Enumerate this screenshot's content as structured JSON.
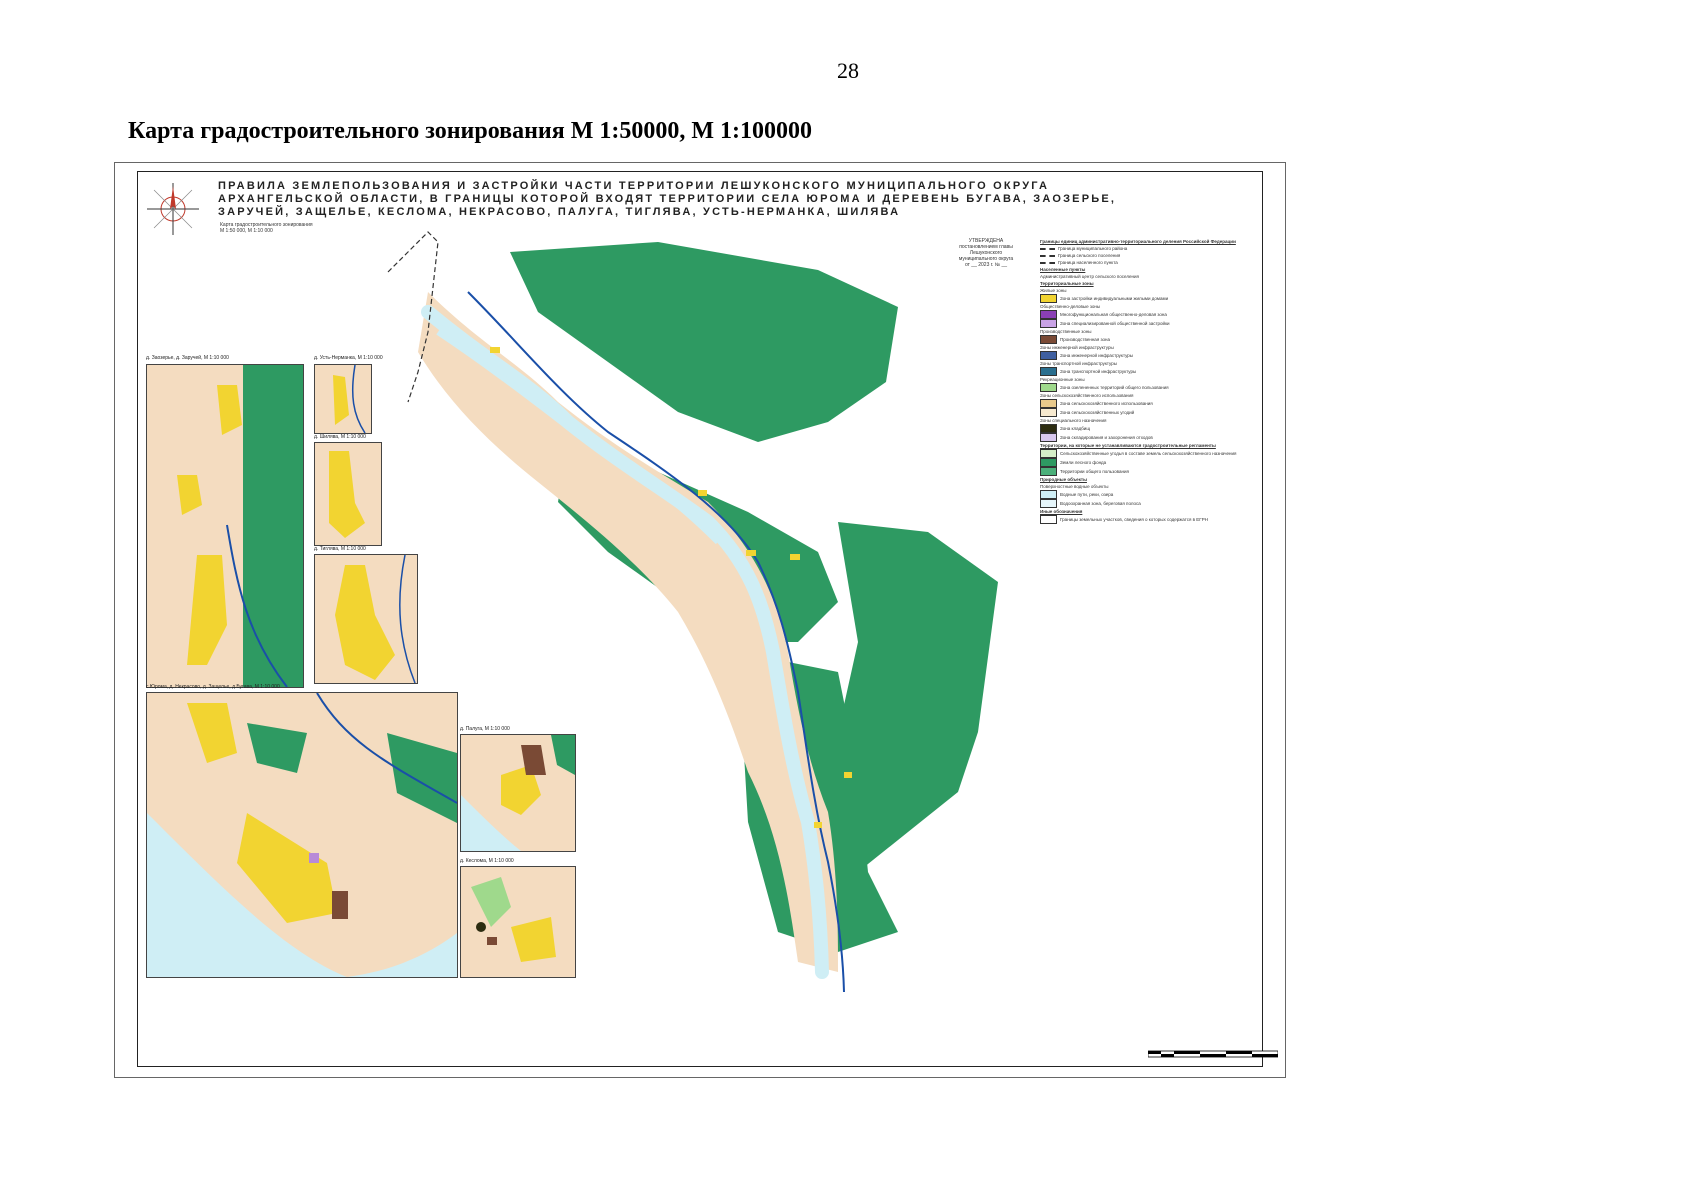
{
  "page": {
    "number": "28",
    "heading": "Карта градостроительного зонирования М 1:50000, М 1:100000"
  },
  "map": {
    "title_lines": [
      "ПРАВИЛА ЗЕМЛЕПОЛЬЗОВАНИЯ И ЗАСТРОЙКИ ЧАСТИ ТЕРРИТОРИИ ЛЕШУКОНСКОГО МУНИЦИПАЛЬНОГО ОКРУГА",
      "АРХАНГЕЛЬСКОЙ ОБЛАСТИ, В ГРАНИЦЫ КОТОРОЙ ВХОДЯТ ТЕРРИТОРИИ СЕЛА ЮРОМА И ДЕРЕВЕНЬ БУГАВА, ЗАОЗЕРЬЕ,",
      "ЗАРУЧЕЙ, ЗАЩЕЛЬЕ, КЕСЛОМА, НЕКРАСОВО, ПАЛУГА, ТИГЛЯВА, УСТЬ-НЕРМАНКА, ШИЛЯВА"
    ],
    "subtitle_lines": [
      "Карта градостроительного зонирования",
      "М 1:50 000, М 1:10 000"
    ],
    "approval_lines": [
      "УТВЕРЖДЕНА",
      "постановлением главы",
      "Лешуконского",
      "муниципального округа",
      "от __ 2023 г. № __"
    ],
    "colors": {
      "forest": "#2e9a62",
      "river": "#cfeef5",
      "agricultural": "#f4dcc0",
      "residential": "#f2d431",
      "public": "#b88ad8",
      "production": "#7a4a35",
      "engineering": "#3f5fa0",
      "roads": "#1a4fa8",
      "recreation": "#9fd98c"
    },
    "insets": [
      {
        "label": "д. Заозерье, д. Заручей, М 1:10 000"
      },
      {
        "label": "д. Усть-Нерманка, М 1:10 000"
      },
      {
        "label": "д. Шилява, М 1:10 000"
      },
      {
        "label": "д. Тиглява, М 1:10 000"
      },
      {
        "label": "с.Юрома, д. Некрасово, д. Защелье, д.Бугава, М 1:10 000"
      },
      {
        "label": "д. Палуга, М 1:10 000"
      },
      {
        "label": "д. Кеслома, М 1:10 000"
      }
    ]
  },
  "legend": {
    "items": [
      {
        "kind": "head",
        "text": "Границы единиц административно-территориального деления Российской Федерации"
      },
      {
        "kind": "line",
        "text": "Граница муниципального района"
      },
      {
        "kind": "line",
        "text": "Граница сельского поселения"
      },
      {
        "kind": "line",
        "text": "Граница населенного пункта"
      },
      {
        "kind": "head",
        "text": "Населенные пункты"
      },
      {
        "kind": "text",
        "text": "Административный центр сельского поселения"
      },
      {
        "kind": "head",
        "text": "Территориальные зоны"
      },
      {
        "kind": "text",
        "text": "Жилые зоны"
      },
      {
        "kind": "swatch",
        "color": "#f2d431",
        "text": "Зона застройки индивидуальными жилыми домами"
      },
      {
        "kind": "text",
        "text": "Общественно-деловые зоны"
      },
      {
        "kind": "swatch",
        "color": "#8a3fb5",
        "text": "Многофункциональная общественно-деловая зона"
      },
      {
        "kind": "swatch",
        "color": "#c9a3e6",
        "text": "Зона специализированной общественной застройки"
      },
      {
        "kind": "text",
        "text": "Производственные зоны"
      },
      {
        "kind": "swatch",
        "color": "#7a4a35",
        "text": "Производственная зона"
      },
      {
        "kind": "text",
        "text": "Зоны инженерной инфраструктуры"
      },
      {
        "kind": "swatch",
        "color": "#3f5fa0",
        "text": "Зона инженерной инфраструктуры"
      },
      {
        "kind": "text",
        "text": "Зоны транспортной инфраструктуры"
      },
      {
        "kind": "swatch",
        "color": "#2a6f8f",
        "text": "Зона транспортной инфраструктуры"
      },
      {
        "kind": "text",
        "text": "Рекреационные зоны"
      },
      {
        "kind": "swatch",
        "color": "#9fd98c",
        "text": "Зона озелененных территорий общего пользования"
      },
      {
        "kind": "text",
        "text": "Зоны сельскохозяйственного использования"
      },
      {
        "kind": "swatch",
        "color": "#e8c98c",
        "text": "Зона сельскохозяйственного использования"
      },
      {
        "kind": "swatch",
        "color": "#f7ead0",
        "text": "Зона сельскохозяйственных угодий"
      },
      {
        "kind": "text",
        "text": "Зоны специального назначения"
      },
      {
        "kind": "swatch",
        "color": "#2c2c10",
        "text": "Зона кладбищ"
      },
      {
        "kind": "swatch",
        "color": "#d8c8ee",
        "text": "Зона складирования и захоронения отходов"
      },
      {
        "kind": "head",
        "text": "Территории, на которые не устанавливаются градостроительные регламенты"
      },
      {
        "kind": "swatch",
        "color": "#d6efc8",
        "text": "Сельскохозяйственные угодья в составе земель сельскохозяйственного назначения"
      },
      {
        "kind": "swatch",
        "color": "#2e9a62",
        "text": "Земли лесного фонда"
      },
      {
        "kind": "swatch",
        "color": "#4bb07a",
        "text": "Территории общего пользования"
      },
      {
        "kind": "head",
        "text": "Природные объекты"
      },
      {
        "kind": "text",
        "text": "Поверхностные водные объекты"
      },
      {
        "kind": "swatch",
        "color": "#cfeef5",
        "text": "Водные пути, реки, озера"
      },
      {
        "kind": "swatch",
        "color": "#e6f6fb",
        "text": "Водоохранная зона, береговая полоса"
      },
      {
        "kind": "head",
        "text": "Иные обозначения"
      },
      {
        "kind": "swatch",
        "color": "#ffffff",
        "text": "Границы земельных участков, сведения о которых содержатся в ЕГРН"
      }
    ]
  }
}
